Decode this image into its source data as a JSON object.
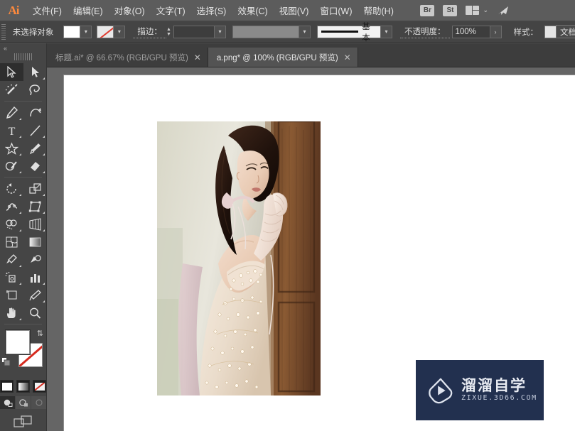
{
  "app": {
    "logo": "Ai",
    "name": "Adobe Illustrator"
  },
  "menubar": {
    "items": [
      {
        "label": "文件(F)",
        "name": "menu-file"
      },
      {
        "label": "编辑(E)",
        "name": "menu-edit"
      },
      {
        "label": "对象(O)",
        "name": "menu-object"
      },
      {
        "label": "文字(T)",
        "name": "menu-type"
      },
      {
        "label": "选择(S)",
        "name": "menu-select"
      },
      {
        "label": "效果(C)",
        "name": "menu-effect"
      },
      {
        "label": "视图(V)",
        "name": "menu-view"
      },
      {
        "label": "窗口(W)",
        "name": "menu-window"
      },
      {
        "label": "帮助(H)",
        "name": "menu-help"
      }
    ],
    "bridge_label": "Br",
    "stock_label": "St",
    "workspace_icon": "workspace-switcher-icon",
    "chevron": "⌄",
    "share_icon": "share-rocket-icon"
  },
  "controlbar": {
    "selection_status": "未选择对象",
    "fill_swatch_color": "#ffffff",
    "stroke_swatch": "none",
    "stroke_label": "描边：",
    "stroke_weight_value": "",
    "profile_value": "",
    "brush_label": "基本",
    "opacity_label": "不透明度：",
    "opacity_value": "100%",
    "style_label": "样式：",
    "style_swatch_color": "#e4e4e4",
    "document_button": "文档"
  },
  "tabs": [
    {
      "title": "标题.ai* @ 66.67% (RGB/GPU 预览)",
      "active": false,
      "close": "✕"
    },
    {
      "title": "a.png* @ 100% (RGB/GPU 预览)",
      "active": true,
      "close": "✕"
    }
  ],
  "toolbar": {
    "collapse_icon": "«",
    "tools": [
      {
        "name": "selection-tool",
        "icon": "selection-arrow-icon",
        "selected": true,
        "corner": false
      },
      {
        "name": "direct-selection-tool",
        "icon": "direct-selection-arrow-icon",
        "selected": false,
        "corner": true
      },
      {
        "name": "magic-wand-tool",
        "icon": "magic-wand-icon",
        "selected": false,
        "corner": false
      },
      {
        "name": "lasso-tool",
        "icon": "lasso-icon",
        "selected": false,
        "corner": false
      },
      {
        "name": "pen-tool",
        "icon": "pen-icon",
        "selected": false,
        "corner": true
      },
      {
        "name": "curvature-tool",
        "icon": "curvature-icon",
        "selected": false,
        "corner": false
      },
      {
        "name": "type-tool",
        "icon": "type-t-icon",
        "selected": false,
        "corner": true
      },
      {
        "name": "line-segment-tool",
        "icon": "line-segment-icon",
        "selected": false,
        "corner": true
      },
      {
        "name": "shape-tool",
        "icon": "star-shape-icon",
        "selected": false,
        "corner": true
      },
      {
        "name": "paintbrush-tool",
        "icon": "paintbrush-icon",
        "selected": false,
        "corner": true
      },
      {
        "name": "shaper-tool",
        "icon": "shaper-pencil-icon",
        "selected": false,
        "corner": true
      },
      {
        "name": "eraser-tool",
        "icon": "eraser-icon",
        "selected": false,
        "corner": true
      },
      {
        "name": "rotate-tool",
        "icon": "rotate-icon",
        "selected": false,
        "corner": true
      },
      {
        "name": "scale-tool",
        "icon": "scale-icon",
        "selected": false,
        "corner": true
      },
      {
        "name": "width-tool",
        "icon": "width-icon",
        "selected": false,
        "corner": true
      },
      {
        "name": "free-transform-tool",
        "icon": "free-transform-icon",
        "selected": false,
        "corner": true
      },
      {
        "name": "shape-builder-tool",
        "icon": "shape-builder-icon",
        "selected": false,
        "corner": true
      },
      {
        "name": "perspective-grid-tool",
        "icon": "perspective-grid-icon",
        "selected": false,
        "corner": true
      },
      {
        "name": "mesh-tool",
        "icon": "mesh-icon",
        "selected": false,
        "corner": false
      },
      {
        "name": "gradient-tool",
        "icon": "gradient-icon",
        "selected": false,
        "corner": false
      },
      {
        "name": "eyedropper-tool",
        "icon": "eyedropper-icon",
        "selected": false,
        "corner": true
      },
      {
        "name": "blend-tool",
        "icon": "blend-icon",
        "selected": false,
        "corner": false
      },
      {
        "name": "symbol-sprayer-tool",
        "icon": "symbol-sprayer-icon",
        "selected": false,
        "corner": true
      },
      {
        "name": "column-graph-tool",
        "icon": "column-graph-icon",
        "selected": false,
        "corner": true
      },
      {
        "name": "artboard-tool",
        "icon": "artboard-icon",
        "selected": false,
        "corner": false
      },
      {
        "name": "slice-tool",
        "icon": "slice-knife-icon",
        "selected": false,
        "corner": true
      },
      {
        "name": "hand-tool",
        "icon": "hand-icon",
        "selected": false,
        "corner": true
      },
      {
        "name": "zoom-tool",
        "icon": "magnifier-icon",
        "selected": false,
        "corner": false
      }
    ],
    "fill_color": "#ffffff",
    "stroke_color": "none",
    "swap_icon": "swap-fill-stroke-icon",
    "default_icon": "default-fill-stroke-icon",
    "modes": [
      {
        "name": "color-mode-button",
        "type": "solid",
        "selected": false
      },
      {
        "name": "gradient-mode-button",
        "type": "gradient",
        "selected": false
      },
      {
        "name": "none-mode-button",
        "type": "none",
        "selected": false
      }
    ],
    "draw_modes": [
      {
        "name": "draw-normal-button",
        "selected": true
      },
      {
        "name": "draw-behind-button",
        "selected": false
      },
      {
        "name": "draw-inside-button",
        "selected": false
      }
    ],
    "screen_mode": {
      "name": "change-screen-mode-button",
      "icon": "screen-mode-icon"
    }
  },
  "canvas": {
    "artboard_background": "#ffffff",
    "canvas_background": "#656565",
    "placed_image": {
      "name": "a.png",
      "alt": "照片：穿米色亮片礼服戴长手套的女性靠在木门旁"
    }
  },
  "watermark": {
    "cn_text": "溜溜自学",
    "en_text": "ZIXUE.3D66.COM",
    "background": "#22304f",
    "play_icon": "play-button-logo-icon"
  }
}
